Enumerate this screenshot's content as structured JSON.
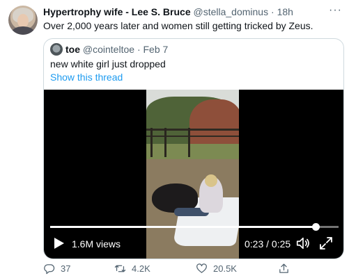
{
  "tweet": {
    "author_name": "Hypertrophy wife - Lee S. Bruce",
    "author_handle": "@stella_dominus",
    "separator": "·",
    "time": "18h",
    "more_icon": "ellipsis-icon",
    "text": "Over 2,000 years later and women still getting tricked by Zeus."
  },
  "quote": {
    "author_name": "toe",
    "author_handle": "@cointeltoe",
    "separator": "·",
    "time": "Feb 7",
    "text": "new white girl just dropped",
    "show_thread": "Show this thread"
  },
  "video": {
    "views": "1.6M views",
    "timer": "0:23 / 0:25",
    "progress": 0.92,
    "play_icon": "play-icon",
    "volume_icon": "volume-icon",
    "fullscreen_icon": "fullscreen-icon"
  },
  "actions": {
    "reply_count": "37",
    "retweet_count": "4.2K",
    "like_count": "20.5K"
  },
  "colors": {
    "link": "#1d9bf0",
    "muted": "#536471",
    "text": "#0f1419",
    "border": "#cfd9de"
  }
}
